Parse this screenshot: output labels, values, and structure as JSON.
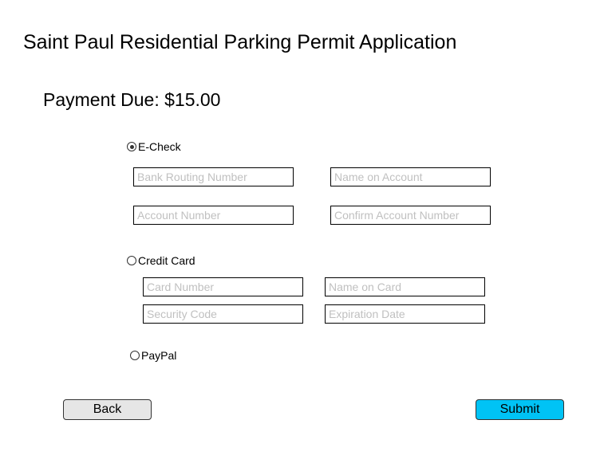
{
  "page": {
    "title": "Saint Paul Residential Parking Permit Application",
    "payment_due_label": "Payment Due: $15.00"
  },
  "payment_methods": {
    "echeck": {
      "label": "E-Check",
      "selected": true,
      "fields": {
        "routing": {
          "placeholder": "Bank Routing Number",
          "value": ""
        },
        "name": {
          "placeholder": "Name on Account",
          "value": ""
        },
        "account": {
          "placeholder": "Account Number",
          "value": ""
        },
        "confirm": {
          "placeholder": "Confirm Account Number",
          "value": ""
        }
      }
    },
    "credit": {
      "label": "Credit Card",
      "selected": false,
      "fields": {
        "number": {
          "placeholder": "Card Number",
          "value": ""
        },
        "name": {
          "placeholder": "Name on Card",
          "value": ""
        },
        "cvv": {
          "placeholder": "Security Code",
          "value": ""
        },
        "expiry": {
          "placeholder": "Expiration Date",
          "value": ""
        }
      }
    },
    "paypal": {
      "label": "PayPal",
      "selected": false
    }
  },
  "buttons": {
    "back": {
      "label": "Back",
      "color": "#e6e6e6"
    },
    "submit": {
      "label": "Submit",
      "color": "#00c3f5"
    }
  }
}
